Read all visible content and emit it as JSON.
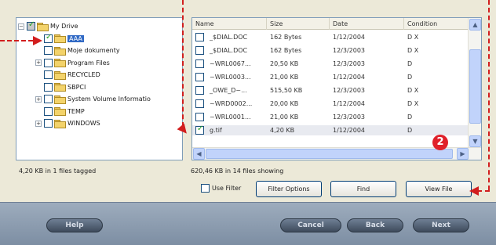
{
  "tree": {
    "items": [
      {
        "label": "My Drive",
        "expander": "−",
        "check": "gray",
        "selected": false
      },
      {
        "label": "AAA",
        "expander": "",
        "check": "on",
        "selected": true
      },
      {
        "label": "Moje dokumenty",
        "expander": "",
        "check": "off",
        "selected": false
      },
      {
        "label": "Program Files",
        "expander": "+",
        "check": "off",
        "selected": false
      },
      {
        "label": "RECYCLED",
        "expander": "",
        "check": "off",
        "selected": false
      },
      {
        "label": "SBPCI",
        "expander": "",
        "check": "off",
        "selected": false
      },
      {
        "label": "System Volume Informatio",
        "expander": "+",
        "check": "off",
        "selected": false
      },
      {
        "label": "TEMP",
        "expander": "",
        "check": "off",
        "selected": false
      },
      {
        "label": "WINDOWS",
        "expander": "+",
        "check": "off",
        "selected": false
      }
    ]
  },
  "files": {
    "columns": [
      "Name",
      "Size",
      "Date",
      "Condition"
    ],
    "rows": [
      {
        "name": "_$DIAL.DOC",
        "size": "162 Bytes",
        "date": "1/12/2004",
        "cond": "D X",
        "checked": false
      },
      {
        "name": "_$DIAL.DOC",
        "size": "162 Bytes",
        "date": "12/3/2003",
        "cond": "D X",
        "checked": false
      },
      {
        "name": "~WRL0067...",
        "size": "20,50 KB",
        "date": "12/3/2003",
        "cond": "D",
        "checked": false
      },
      {
        "name": "~WRL0003...",
        "size": "21,00 KB",
        "date": "1/12/2004",
        "cond": "D",
        "checked": false
      },
      {
        "name": "_OWE_D~...",
        "size": "515,50 KB",
        "date": "12/3/2003",
        "cond": "D X",
        "checked": false
      },
      {
        "name": "~WRD0002...",
        "size": "20,00 KB",
        "date": "1/12/2004",
        "cond": "D X",
        "checked": false
      },
      {
        "name": "~WRL0001...",
        "size": "21,00 KB",
        "date": "12/3/2003",
        "cond": "D",
        "checked": false
      },
      {
        "name": "g.tif",
        "size": "4,20 KB",
        "date": "1/12/2004",
        "cond": "D",
        "checked": true
      }
    ]
  },
  "status": {
    "tagged": "4,20 KB in 1 files tagged",
    "showing": "620,46 KB in 14 files showing"
  },
  "controls": {
    "use_filter": "Use Filter",
    "filter_options": "Filter Options",
    "find": "Find",
    "view_file": "View File"
  },
  "bottom": {
    "help": "Help",
    "cancel": "Cancel",
    "back": "Back",
    "next": "Next"
  },
  "callout": {
    "number": "2",
    "color": "#d21e1e"
  }
}
